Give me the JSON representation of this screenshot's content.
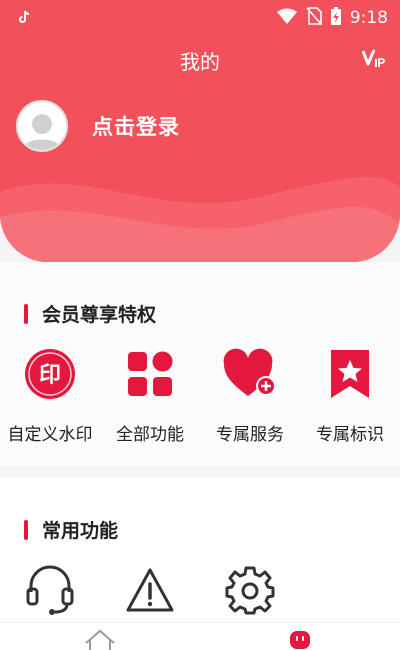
{
  "status_bar": {
    "time": "9:18"
  },
  "header": {
    "title": "我的"
  },
  "login": {
    "text": "点击登录"
  },
  "vip_section": {
    "title": "会员尊享特权",
    "items": [
      {
        "label": "自定义水印",
        "icon": "watermark-icon",
        "badge_text": "印"
      },
      {
        "label": "全部功能",
        "icon": "grid-icon"
      },
      {
        "label": "专属服务",
        "icon": "heart-plus-icon"
      },
      {
        "label": "专属标识",
        "icon": "bookmark-star-icon"
      }
    ]
  },
  "common_section": {
    "title": "常用功能",
    "items": [
      {
        "icon": "headset-icon"
      },
      {
        "icon": "warning-icon"
      },
      {
        "icon": "settings-icon"
      }
    ]
  },
  "bottom_nav": [
    {
      "icon": "home-icon"
    },
    {
      "icon": "profile-face-icon"
    }
  ],
  "colors": {
    "brand": "#f2505a",
    "accent": "#e4173e"
  }
}
